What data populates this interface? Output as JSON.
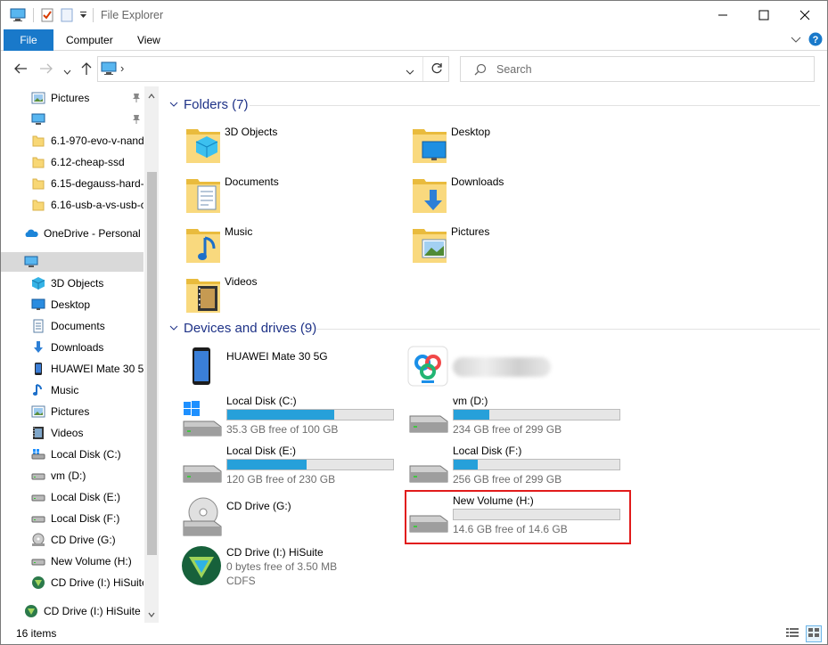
{
  "window": {
    "title": "File Explorer"
  },
  "ribbon": {
    "tabs": [
      "File",
      "Computer",
      "View"
    ]
  },
  "search": {
    "placeholder": "Search"
  },
  "address": {
    "separator": "›"
  },
  "sidebar": {
    "items": [
      {
        "label": "Pictures",
        "icon": "pictures-icon",
        "pinned": true
      },
      {
        "label": "",
        "icon": "this-pc-icon",
        "pinned": true
      },
      {
        "label": "6.1-970-evo-v-nand",
        "icon": "folder-icon"
      },
      {
        "label": "6.12-cheap-ssd",
        "icon": "folder-icon"
      },
      {
        "label": "6.15-degauss-hard-",
        "icon": "folder-icon"
      },
      {
        "label": "6.16-usb-a-vs-usb-c",
        "icon": "folder-icon"
      },
      {
        "label": "OneDrive - Personal",
        "icon": "onedrive-icon"
      },
      {
        "label": "",
        "icon": "this-pc-icon",
        "selected": true
      },
      {
        "label": "3D Objects",
        "icon": "3d-objects-icon"
      },
      {
        "label": "Desktop",
        "icon": "desktop-icon"
      },
      {
        "label": "Documents",
        "icon": "documents-icon"
      },
      {
        "label": "Downloads",
        "icon": "downloads-icon"
      },
      {
        "label": "HUAWEI Mate 30 5G",
        "icon": "phone-icon"
      },
      {
        "label": "Music",
        "icon": "music-icon"
      },
      {
        "label": "Pictures",
        "icon": "pictures-icon"
      },
      {
        "label": "Videos",
        "icon": "videos-icon"
      },
      {
        "label": "Local Disk (C:)",
        "icon": "windows-drive-icon"
      },
      {
        "label": "vm (D:)",
        "icon": "drive-icon"
      },
      {
        "label": "Local Disk (E:)",
        "icon": "drive-icon"
      },
      {
        "label": "Local Disk (F:)",
        "icon": "drive-icon"
      },
      {
        "label": "CD Drive (G:)",
        "icon": "cd-drive-icon"
      },
      {
        "label": "New Volume (H:)",
        "icon": "drive-icon"
      },
      {
        "label": "CD Drive (I:) HiSuite",
        "icon": "hisuite-icon"
      },
      {
        "label": "CD Drive (I:) HiSuite",
        "icon": "hisuite-icon"
      }
    ]
  },
  "folders": {
    "header": "Folders (7)",
    "items": [
      {
        "label": "3D Objects",
        "icon": "3d-objects-icon"
      },
      {
        "label": "Desktop",
        "icon": "desktop-icon"
      },
      {
        "label": "Documents",
        "icon": "documents-icon"
      },
      {
        "label": "Downloads",
        "icon": "downloads-icon"
      },
      {
        "label": "Music",
        "icon": "music-icon"
      },
      {
        "label": "Pictures",
        "icon": "pictures-icon"
      },
      {
        "label": "Videos",
        "icon": "videos-icon"
      }
    ]
  },
  "devices": {
    "header": "Devices and drives (9)",
    "items": [
      {
        "name": "HUAWEI Mate 30 5G",
        "icon": "phone-icon"
      },
      {
        "name": "",
        "icon": "app-icon"
      },
      {
        "name": "Local Disk (C:)",
        "free": "35.3 GB free of 100 GB",
        "used_fraction": 0.647,
        "icon": "windows-drive-icon"
      },
      {
        "name": "vm (D:)",
        "free": "234 GB free of 299 GB",
        "used_fraction": 0.217,
        "icon": "drive-icon"
      },
      {
        "name": "Local Disk (E:)",
        "free": "120 GB free of 230 GB",
        "used_fraction": 0.478,
        "icon": "drive-icon"
      },
      {
        "name": "Local Disk (F:)",
        "free": "256 GB free of 299 GB",
        "used_fraction": 0.144,
        "icon": "drive-icon"
      },
      {
        "name": "CD Drive (G:)",
        "icon": "cd-drive-icon"
      },
      {
        "name": "New Volume (H:)",
        "free": "14.6 GB free of 14.6 GB",
        "used_fraction": 0.0,
        "icon": "drive-icon",
        "highlighted": true
      },
      {
        "name": "CD Drive (I:) HiSuite",
        "free": "0 bytes free of 3.50 MB",
        "fs": "CDFS",
        "icon": "hisuite-icon"
      }
    ]
  },
  "status": {
    "count": "16 items"
  },
  "colors": {
    "accent": "#1979ca",
    "bar_fill": "#26a0da",
    "highlight": "#e11b1b",
    "group_header": "#1e3287"
  }
}
